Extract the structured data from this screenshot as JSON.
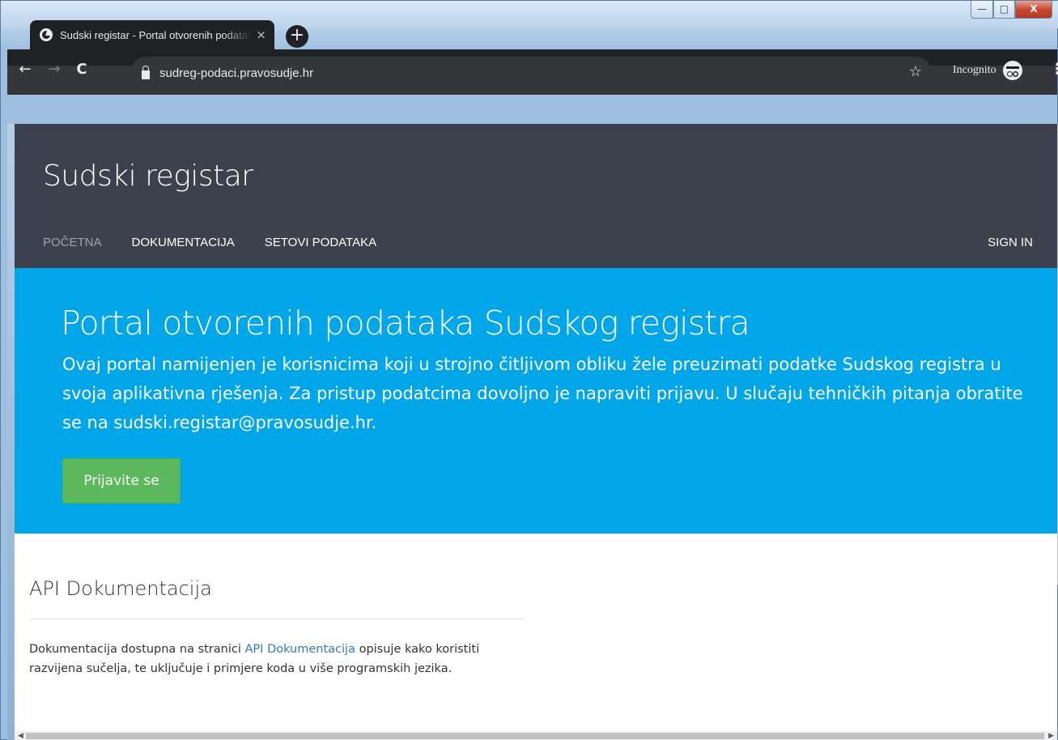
{
  "browser": {
    "tab_title": "Sudski registar - Portal otvorenih podataka",
    "tab_close": "×",
    "new_tab": "+",
    "url": "sudreg-podaci.pravosudje.hr",
    "incognito_label": "Incognito",
    "window_buttons": {
      "minimize": "—",
      "maximize": "□",
      "close": "X"
    }
  },
  "site": {
    "brand": "Sudski registar",
    "nav": [
      "POČETNA",
      "DOKUMENTACIJA",
      "SETOVI PODATAKA"
    ],
    "sign_in": "SIGN IN"
  },
  "hero": {
    "title": "Portal otvorenih podataka Sudskog registra",
    "text": "Ovaj portal namijenjen je korisnicima koji u strojno čitljivom obliku žele preuzimati podatke Sudskog registra u svoja aplikativna rješenja. Za pristup podatcima dovoljno je napraviti prijavu. U slučaju tehničkih pitanja obratite se na sudski.registar@pravosudje.hr.",
    "button": "Prijavite se"
  },
  "api_section": {
    "title": "API Dokumentacija",
    "text_before": "Dokumentacija dostupna na stranici ",
    "link": "API Dokumentacija",
    "text_after": " opisuje kako koristiti razvijena sučelja, te uključuje i primjere koda u više programskih jezika."
  },
  "colors": {
    "header_bg": "#3c414d",
    "hero_bg": "#00a6e7",
    "button_green": "#5cb85c",
    "link": "#337ab7"
  }
}
